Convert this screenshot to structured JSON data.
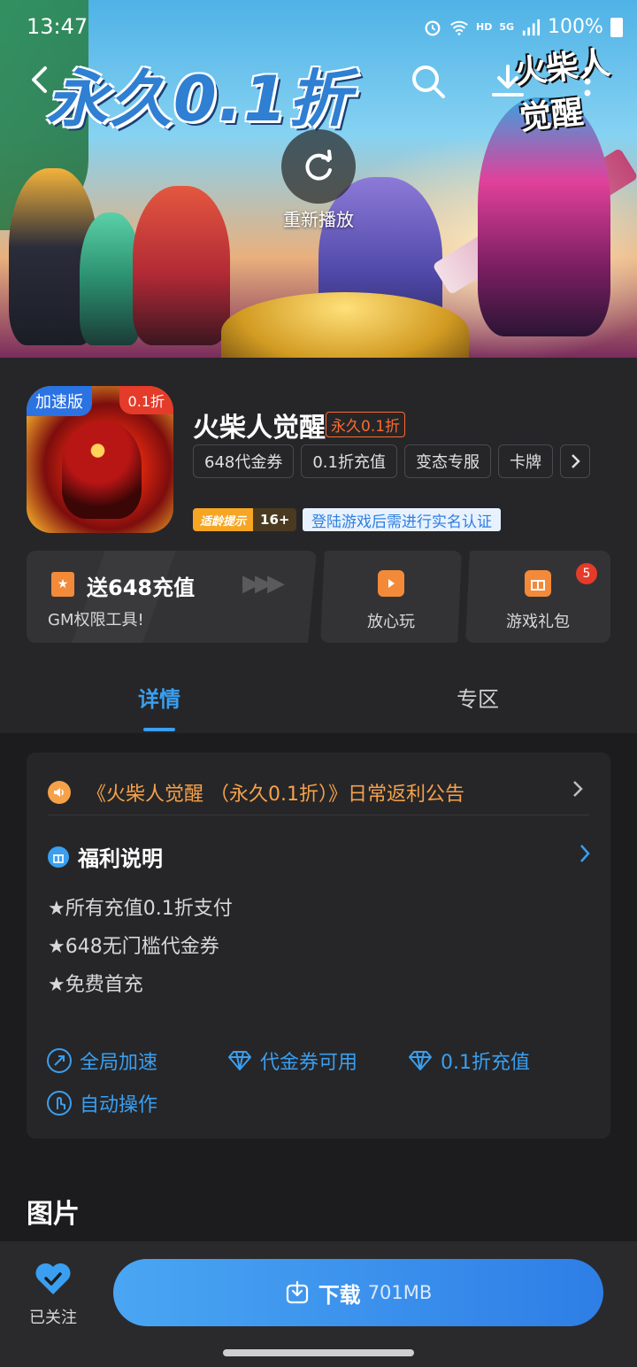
{
  "status_bar": {
    "time": "13:47",
    "network": "5G",
    "hd": "HD",
    "battery": "100%"
  },
  "banner": {
    "title": "永久0.1折",
    "brand": "火柴人觉醒",
    "replay_label": "重新播放"
  },
  "game": {
    "title": "火柴人觉醒",
    "title_tag": "永久0.1折",
    "icon_tag_speed": "加速版",
    "icon_tag_discount": "0.1折",
    "chips": [
      "648代金券",
      "0.1折充值",
      "变态专服",
      "卡牌"
    ],
    "age_hint": "适龄提示",
    "age_rating": "16+",
    "realname_notice": "登陆游戏后需进行实名认证"
  },
  "cards": {
    "gm": {
      "headline": "送648充值",
      "sub": "GM权限工具!"
    },
    "play": {
      "label": "放心玩"
    },
    "gift": {
      "label": "游戏礼包",
      "badge": "5"
    }
  },
  "tabs": [
    "详情",
    "专区"
  ],
  "active_tab": "详情",
  "detail": {
    "notice": "《火柴人觉醒 （永久0.1折）》日常返利公告",
    "welfare_title": "福利说明",
    "perks": [
      "★所有充值0.1折支付",
      "★648无门槛代金券",
      "★免费首充"
    ],
    "features": [
      "全局加速",
      "代金券可用",
      "0.1折充值",
      "自动操作"
    ]
  },
  "section_title": "图片",
  "bottom": {
    "follow_label": "已关注",
    "download_label": "下载",
    "download_size": "701MB"
  },
  "colors": {
    "accent": "#3a9ff0",
    "warning": "#f5a14a",
    "badge": "#e53b2a"
  }
}
